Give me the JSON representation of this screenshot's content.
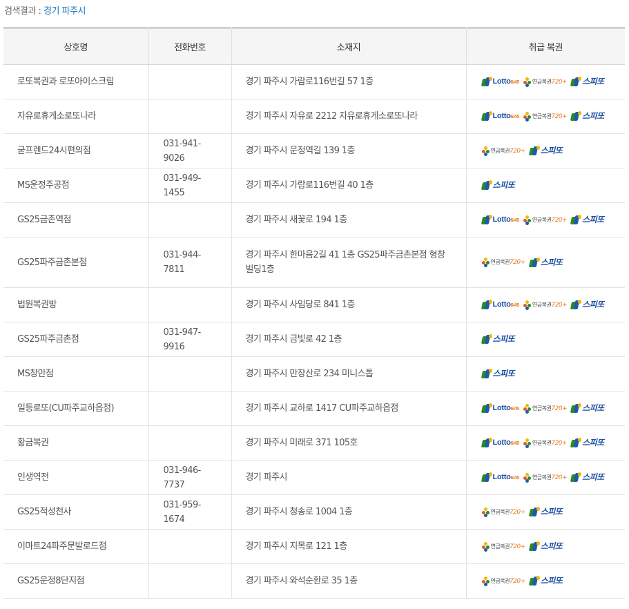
{
  "search": {
    "prefix": "검색결과 : ",
    "query": "경기 파주시"
  },
  "table": {
    "headers": [
      "상호명",
      "전화번호",
      "소재지",
      "취급 복권"
    ],
    "rows": [
      {
        "name": "로또복권과 로또아이스크림",
        "tel": "",
        "addr": "경기 파주시 가람로116번길 57 1층",
        "products": [
          "lotto",
          "pension",
          "speetto"
        ]
      },
      {
        "name": "자유로휴게소로또나라",
        "tel": "",
        "addr": "경기 파주시 자유로 2212 자유로휴게소로또나라",
        "products": [
          "lotto",
          "pension",
          "speetto"
        ]
      },
      {
        "name": "굳프렌드24시편의점",
        "tel": "031-941-9026",
        "addr": "경기 파주시 운정역길 139 1층",
        "products": [
          "pension",
          "speetto"
        ]
      },
      {
        "name": "MS운정주공점",
        "tel": "031-949-1455",
        "addr": "경기 파주시 가람로116번길 40 1층",
        "products": [
          "speetto"
        ]
      },
      {
        "name": "GS25금촌역점",
        "tel": "",
        "addr": "경기 파주시 새꽃로 194 1층",
        "products": [
          "lotto",
          "pension",
          "speetto"
        ]
      },
      {
        "name": "GS25파주금촌본점",
        "tel": "031-944-7811",
        "addr": "경기 파주시 한마음2길 41 1층 GS25파주금촌본점 형창빌딩1층",
        "products": [
          "pension",
          "speetto"
        ]
      },
      {
        "name": "법원복권방",
        "tel": "",
        "addr": "경기 파주시 사임당로 841 1층",
        "products": [
          "lotto",
          "pension",
          "speetto"
        ]
      },
      {
        "name": "GS25파주금촌점",
        "tel": "031-947-9916",
        "addr": "경기 파주시 금빛로 42 1층",
        "products": [
          "speetto"
        ]
      },
      {
        "name": "MS창만점",
        "tel": "",
        "addr": "경기 파주시 만장산로 234 미니스톱",
        "products": [
          "speetto"
        ]
      },
      {
        "name": "일등로또(CU파주교하읍점)",
        "tel": "",
        "addr": "경기 파주시 교하로 1417 CU파주교하읍점",
        "products": [
          "lotto",
          "pension",
          "speetto"
        ]
      },
      {
        "name": "황금복권",
        "tel": "",
        "addr": "경기 파주시 미래로 371 105호",
        "products": [
          "lotto",
          "pension",
          "speetto"
        ]
      },
      {
        "name": "인생역전",
        "tel": "031-946-7737",
        "addr": "경기 파주시",
        "products": [
          "lotto",
          "pension",
          "speetto"
        ]
      },
      {
        "name": "GS25적성천사",
        "tel": "031-959-1674",
        "addr": "경기 파주시 청송로 1004 1층",
        "products": [
          "pension",
          "speetto"
        ]
      },
      {
        "name": "이마트24파주문발로드점",
        "tel": "",
        "addr": "경기 파주시 지목로 121 1층",
        "products": [
          "pension",
          "speetto"
        ]
      },
      {
        "name": "GS25운정8단지점",
        "tel": "",
        "addr": "경기 파주시 와석순환로 35 1층",
        "products": [
          "pension",
          "speetto"
        ]
      }
    ]
  },
  "logos": {
    "lotto": {
      "text": "Lotto",
      "sub": "6/45",
      "icon": "lotto645-logo"
    },
    "pension": {
      "text": "연금복권",
      "sub": "720+",
      "icon": "pension720-logo"
    },
    "speetto": {
      "text": "스피또",
      "icon": "speetto-logo"
    }
  },
  "colors": {
    "query": "#1a73b5",
    "header_bg": "#f5f5f5",
    "brand_blue": "#1d4fa3",
    "brand_orange": "#e47b1c"
  }
}
